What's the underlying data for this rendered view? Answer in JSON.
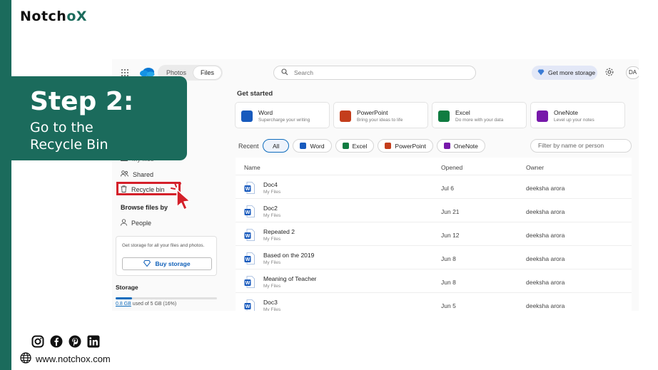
{
  "brand": {
    "name_prefix": "Notch",
    "name_o": "o",
    "name_x": "X",
    "website": "www.notchox.com"
  },
  "step": {
    "title": "Step 2:",
    "line1": "Go to the",
    "line2": "Recycle Bin"
  },
  "social_icons": [
    "instagram-icon",
    "facebook-icon",
    "pinterest-icon",
    "linkedin-icon"
  ],
  "topbar": {
    "toggle": [
      "Photos",
      "Files"
    ],
    "search_placeholder": "Search",
    "storage_button": "Get more storage",
    "avatar": "DA"
  },
  "sidebar": {
    "my_files": "My files",
    "shared": "Shared",
    "recycle_bin": "Recycle bin",
    "browse_heading": "Browse files by",
    "people": "People",
    "promo_text": "Get storage for all your files and photos.",
    "buy_storage": "Buy storage",
    "storage_heading": "Storage",
    "storage_used": "0.8 GB",
    "storage_rest": " used of 5 GB (16%)",
    "storage_fraction": 0.16
  },
  "get_started": {
    "heading": "Get started",
    "cards": [
      {
        "title": "Word",
        "subtitle": "Supercharge your writing",
        "color": "#185abd"
      },
      {
        "title": "PowerPoint",
        "subtitle": "Bring your ideas to life",
        "color": "#c43e1c"
      },
      {
        "title": "Excel",
        "subtitle": "Do more with your data",
        "color": "#107c41"
      },
      {
        "title": "OneNote",
        "subtitle": "Level up your notes",
        "color": "#7719aa"
      }
    ]
  },
  "recent": {
    "label": "Recent",
    "chips": [
      "All",
      "Word",
      "Excel",
      "PowerPoint",
      "OneNote"
    ],
    "filter_placeholder": "Filter by name or person"
  },
  "table": {
    "headers": {
      "name": "Name",
      "opened": "Opened",
      "owner": "Owner"
    },
    "rows": [
      {
        "name": "Doc4",
        "location": "My Files",
        "opened": "Jul 6",
        "owner": "deeksha arora"
      },
      {
        "name": "Doc2",
        "location": "My Files",
        "opened": "Jun 21",
        "owner": "deeksha arora"
      },
      {
        "name": "Repeated 2",
        "location": "My Files",
        "opened": "Jun 12",
        "owner": "deeksha arora"
      },
      {
        "name": "Based on the 2019",
        "location": "My Files",
        "opened": "Jun 8",
        "owner": "deeksha arora"
      },
      {
        "name": "Meaning of Teacher",
        "location": "My Files",
        "opened": "Jun 8",
        "owner": "deeksha arora"
      },
      {
        "name": "Doc3",
        "location": "My Files",
        "opened": "Jun 5",
        "owner": "deeksha arora"
      }
    ]
  },
  "colors": {
    "brand_green": "#1b6b5c",
    "highlight_red": "#d4202a",
    "word_blue": "#185abd"
  }
}
